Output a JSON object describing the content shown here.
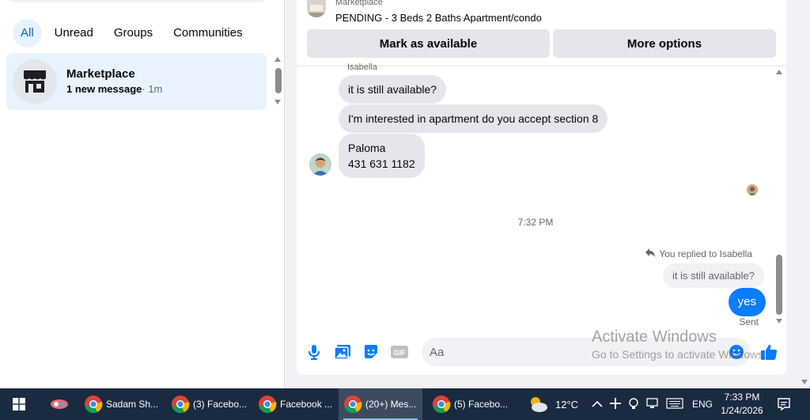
{
  "sidebar": {
    "filters": [
      {
        "label": "All",
        "active": true
      },
      {
        "label": "Unread",
        "active": false
      },
      {
        "label": "Groups",
        "active": false
      },
      {
        "label": "Communities",
        "active": false
      }
    ],
    "chats": [
      {
        "name": "Marketplace",
        "status": "1 new message",
        "time": "· 1m",
        "icon": "store-icon"
      }
    ]
  },
  "listing": {
    "kicker": "Marketplace",
    "title": "PENDING - 3 Beds 2 Baths Apartment/condo",
    "mark_available_label": "Mark as available",
    "more_options_label": "More options"
  },
  "conversation": {
    "sender_name": "Isabella",
    "incoming": [
      "it is still available?",
      "I'm interested in apartment do you accept section 8",
      "Paloma\n431 631 1182"
    ],
    "timestamp": "7:32 PM",
    "reply_note": "You replied to Isabella",
    "replied_to_text": "it is still available?",
    "outgoing": "yes",
    "status": "Sent"
  },
  "composer": {
    "placeholder": "Aa",
    "icons": [
      "microphone-icon",
      "photo-icon",
      "sticker-icon",
      "gif-icon",
      "emoji-icon",
      "thumbs-up-icon"
    ]
  },
  "watermark": {
    "title": "Activate Windows",
    "subtitle": "Go to Settings to activate Windows."
  },
  "taskbar": {
    "apps": [
      {
        "label": "Sadam Sh...",
        "active": false
      },
      {
        "label": "(3) Facebo...",
        "active": false
      },
      {
        "label": "Facebook ...",
        "active": false
      },
      {
        "label": "(20+) Mes...",
        "active": true
      },
      {
        "label": "(5) Facebo...",
        "active": false
      }
    ],
    "weather": "12°C",
    "language": "ENG",
    "time": "7:33 PM",
    "date": "1/24/2026"
  },
  "colors": {
    "accent": "#0a7cff",
    "selected_bg": "#e7f3ff",
    "bubble_in": "#e4e6eb",
    "taskbar": "#1a2a40"
  }
}
